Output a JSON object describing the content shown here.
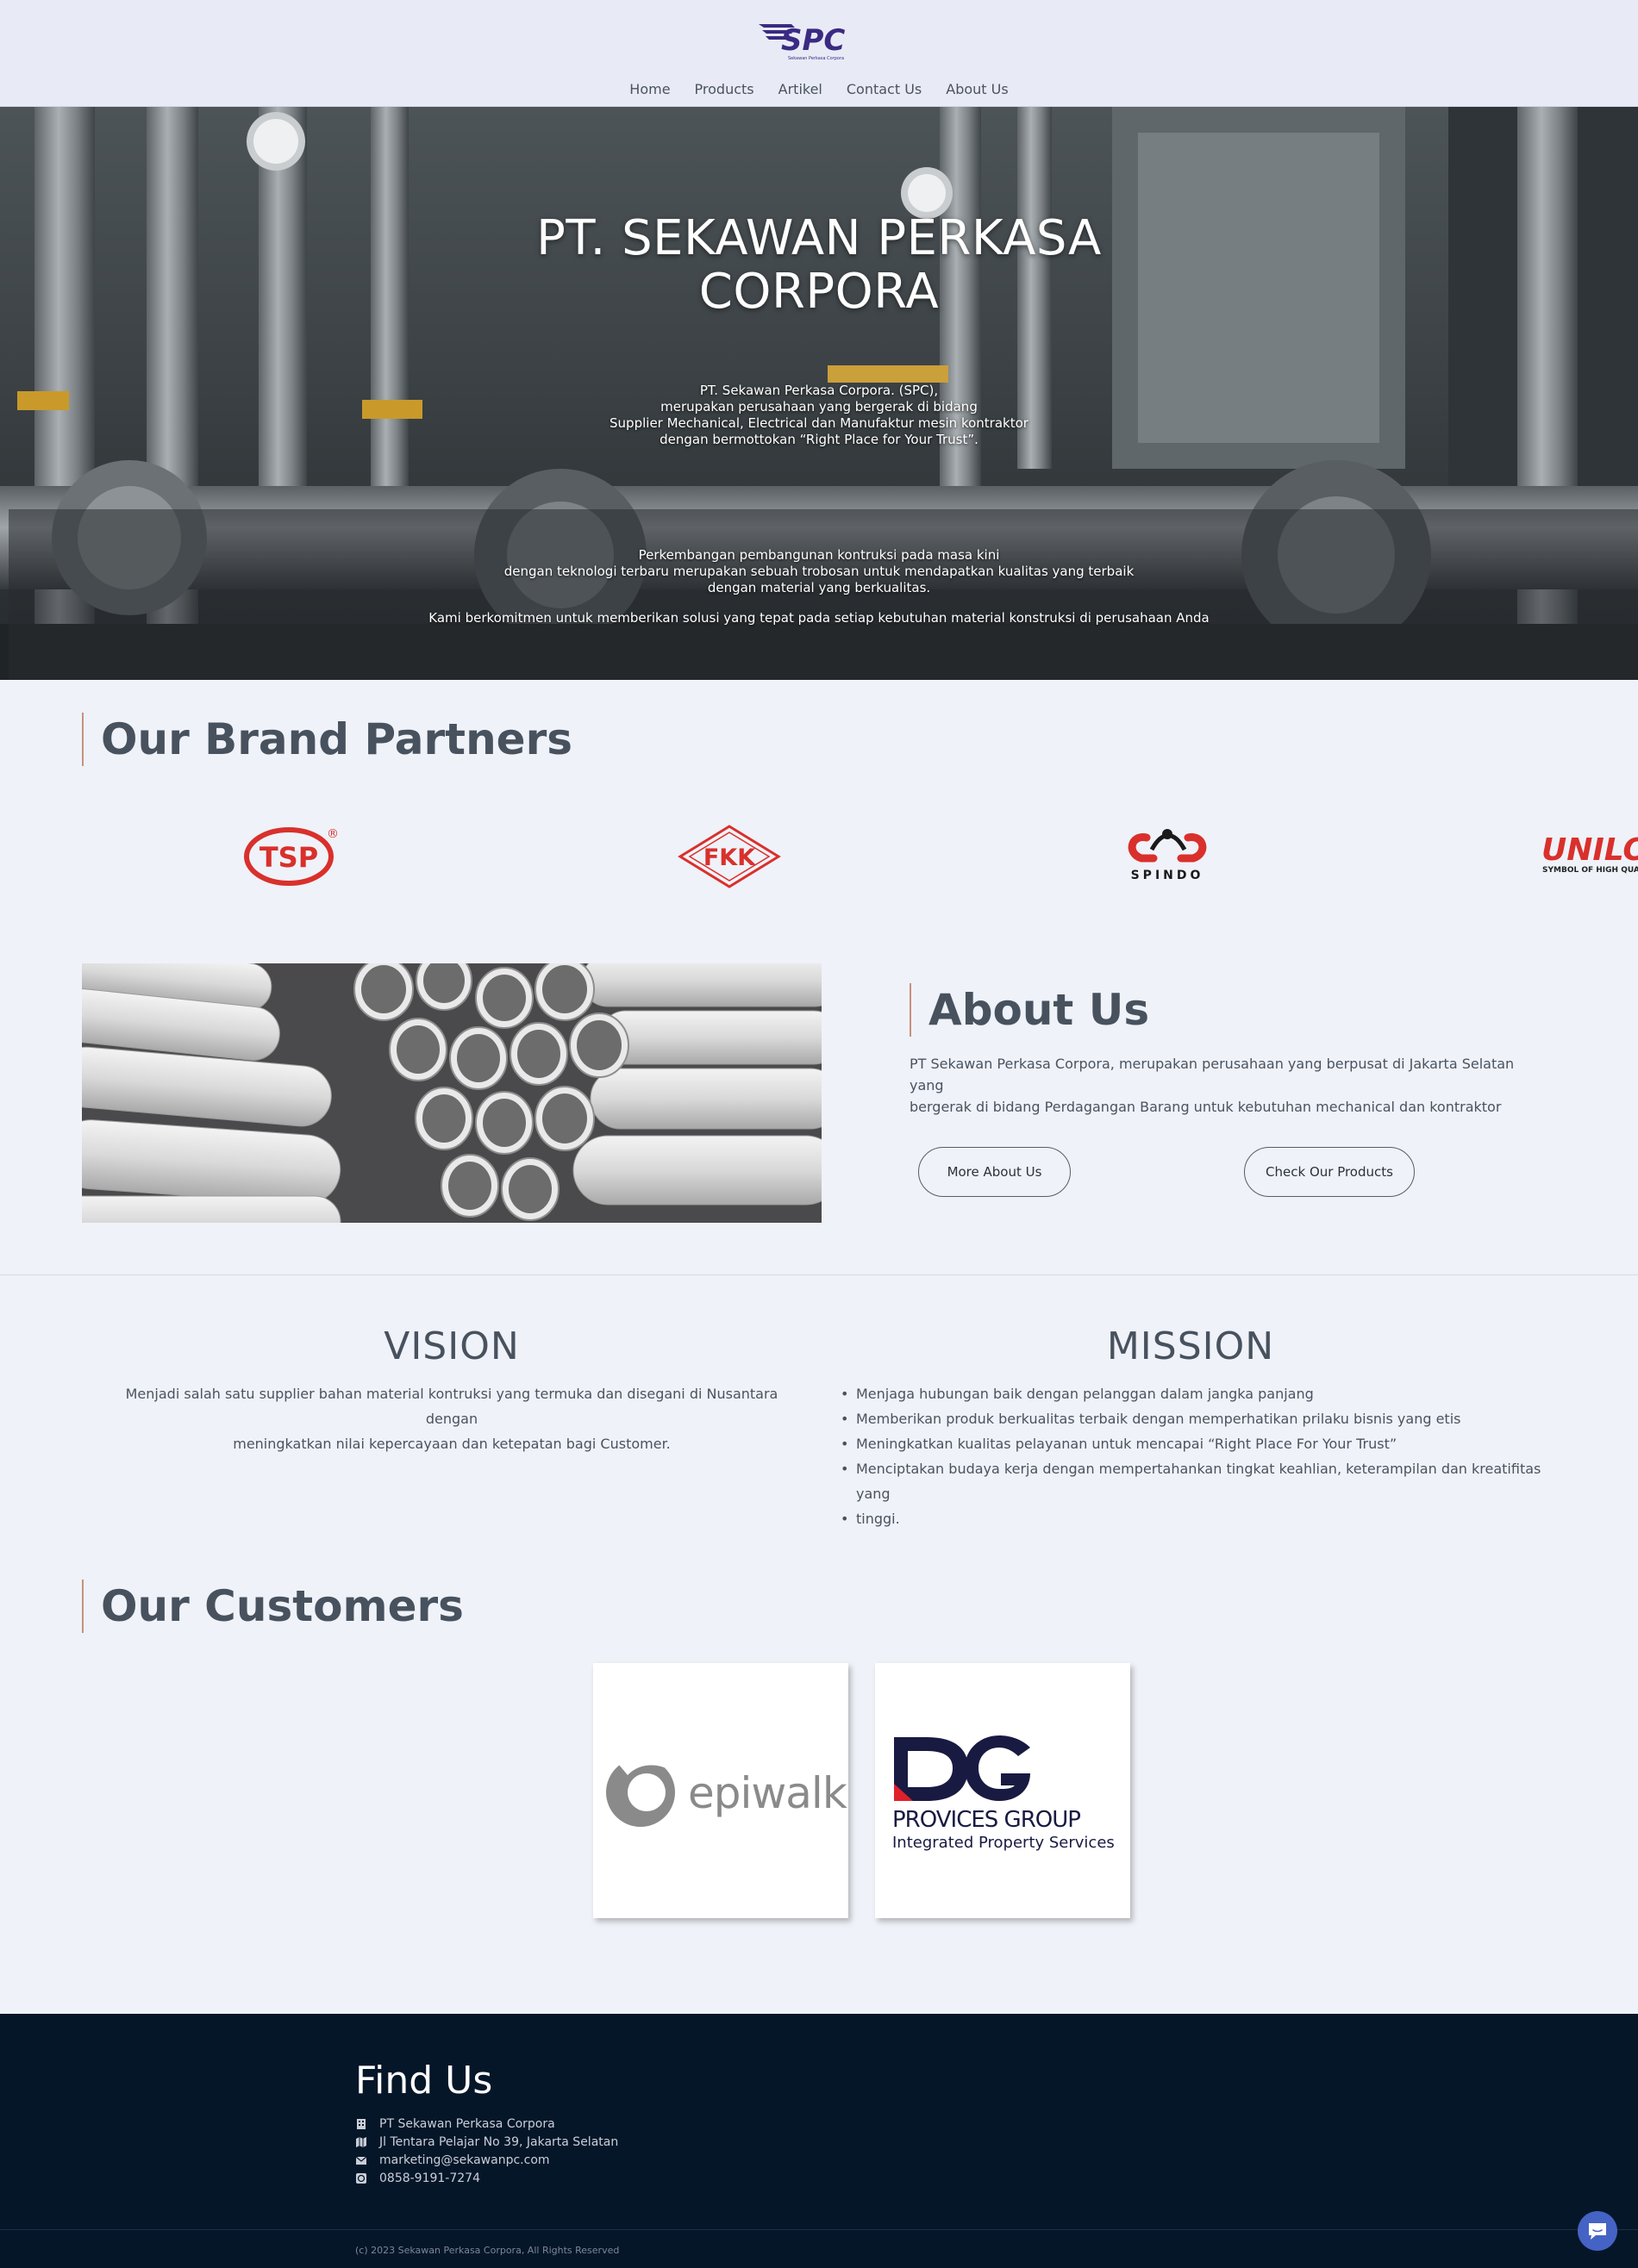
{
  "brand": {
    "logo_text": "SPC",
    "logo_tagline": "Sekawan Perkasa Corpora"
  },
  "nav": [
    {
      "label": "Home"
    },
    {
      "label": "Products"
    },
    {
      "label": "Artikel"
    },
    {
      "label": "Contact Us"
    },
    {
      "label": "About Us"
    }
  ],
  "hero": {
    "title_line1": "PT. SEKAWAN PERKASA",
    "title_line2": "CORPORA",
    "intro": [
      "PT. Sekawan Perkasa Corpora. (SPC),",
      "merupakan perusahaan yang bergerak di bidang",
      "Supplier Mechanical, Electrical dan Manufaktur mesin kontraktor",
      "dengan bermottokan “Right Place for Your Trust”."
    ],
    "paragraph1": [
      "Perkembangan pembangunan kontruksi pada masa kini",
      "dengan teknologi terbaru merupakan sebuah trobosan untuk mendapatkan kualitas yang terbaik",
      "dengan material yang berkualitas."
    ],
    "paragraph2": "Kami berkomitmen untuk memberikan solusi yang tepat pada setiap kebutuhan material konstruksi di perusahaan Anda"
  },
  "brand_partners": {
    "heading": "Our Brand Partners",
    "logos": [
      {
        "name": "TSP",
        "mark": "®",
        "color": "#d9302c"
      },
      {
        "name": "FKK",
        "color": "#d9302c"
      },
      {
        "name": "SPINDO",
        "color": "#d9302c"
      },
      {
        "name": "UNILO",
        "tagline": "SYMBOL OF HIGH QUALITY",
        "color": "#d9302c"
      }
    ]
  },
  "about": {
    "heading": "About Us",
    "text_line1": "PT Sekawan Perkasa Corpora, merupakan perusahaan yang berpusat di Jakarta Selatan yang",
    "text_line2": "bergerak di bidang Perdagangan Barang untuk kebutuhan mechanical dan kontraktor",
    "more_button": "More About Us",
    "products_button": "Check Our Products"
  },
  "vision": {
    "title": "VISION",
    "text_line1": "Menjadi salah satu supplier bahan material kontruksi yang termuka dan disegani di Nusantara dengan",
    "text_line2": "meningkatkan nilai kepercayaan dan ketepatan bagi Customer."
  },
  "mission": {
    "title": "MISSION",
    "items": [
      "Menjaga hubungan baik dengan pelanggan dalam jangka panjang",
      "Memberikan produk berkualitas terbaik dengan memperhatikan prilaku bisnis yang etis",
      "Meningkatkan kualitas pelayanan untuk mencapai “Right Place For Your Trust”",
      "Menciptakan budaya kerja dengan mempertahankan tingkat keahlian, keterampilan dan kreatifitas yang",
      "tinggi."
    ]
  },
  "customers": {
    "heading": "Our Customers",
    "logos": [
      {
        "name": "epiwalk"
      },
      {
        "name": "DG",
        "line1": "PROVICES GROUP",
        "line2": "Integrated Property Services"
      }
    ]
  },
  "footer": {
    "heading": "Find Us",
    "company": "PT Sekawan Perkasa Corpora",
    "address": "Jl Tentara Pelajar No 39, Jakarta Selatan",
    "email": "marketing@sekawanpc.com",
    "phone": "0858-9191-7274",
    "copyright": "(c) 2023 Sekawan Perkasa Corpora, All Rights Reserved"
  },
  "colors": {
    "header_bg": "#e8ebf5",
    "page_bg": "#eff2f8",
    "footer_bg": "#061629",
    "heading_accent": "#c7917c",
    "logo_purple": "#3b2a82",
    "brand_red": "#d9302c",
    "chat_blue": "#4563c4"
  }
}
